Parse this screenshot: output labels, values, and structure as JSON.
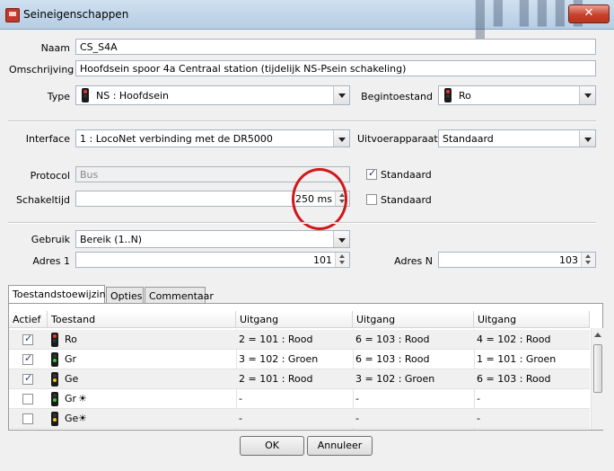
{
  "window": {
    "title": "Seineigenschappen",
    "close": "✕"
  },
  "form": {
    "naam_label": "Naam",
    "naam_value": "CS_S4A",
    "omschrijving_label": "Omschrijving",
    "omschrijving_value": "Hoofdsein spoor 4a Centraal station (tijdelijk NS-Psein schakeling)",
    "type_label": "Type",
    "type_value": "NS : Hoofdsein",
    "begintoestand_label": "Begintoestand",
    "begintoestand_value": "Ro",
    "interface_label": "Interface",
    "interface_value": "1 : LocoNet verbinding met de DR5000",
    "uitvoer_label": "Uitvoerapparaat",
    "uitvoer_value": "Standaard",
    "protocol_label": "Protocol",
    "protocol_value": "Bus",
    "protocol_std_label": "Standaard",
    "schakeltijd_label": "Schakeltijd",
    "schakeltijd_value": "250 ms",
    "schakeltijd_std_label": "Standaard",
    "gebruik_label": "Gebruik",
    "gebruik_value": "Bereik (1..N)",
    "adres1_label": "Adres 1",
    "adres1_value": "101",
    "adresN_label": "Adres N",
    "adresN_value": "103"
  },
  "tabs": [
    "Toestandstoewijzing",
    "Opties",
    "Commentaar"
  ],
  "table": {
    "headers": [
      "Actief",
      "Toestand",
      "Uitgang",
      "Uitgang",
      "Uitgang"
    ],
    "rows": [
      {
        "checked": true,
        "state": "Ro",
        "sun": "",
        "u1": "2 = 101 : Rood",
        "u2": "6 = 103 : Rood",
        "u3": "4 = 102 : Rood"
      },
      {
        "checked": true,
        "state": "Gr",
        "sun": "",
        "u1": "3 = 102 : Groen",
        "u2": "6 = 103 : Rood",
        "u3": "1 = 101 : Groen"
      },
      {
        "checked": true,
        "state": "Ge",
        "sun": "",
        "u1": "2 = 101 : Rood",
        "u2": "3 = 102 : Groen",
        "u3": "6 = 103 : Rood"
      },
      {
        "checked": false,
        "state": "Gr",
        "sun": "☀",
        "u1": "-",
        "u2": "-",
        "u3": "-"
      },
      {
        "checked": false,
        "state": "Ge",
        "sun": "☀",
        "u1": "-",
        "u2": "-",
        "u3": "-"
      }
    ]
  },
  "buttons": {
    "ok": "OK",
    "cancel": "Annuleer"
  },
  "colors": {
    "red_lamp": "#e23a2a",
    "green_lamp": "#3cc23c",
    "yellow_lamp": "#f2c21a",
    "highlight": "#d0181c"
  }
}
